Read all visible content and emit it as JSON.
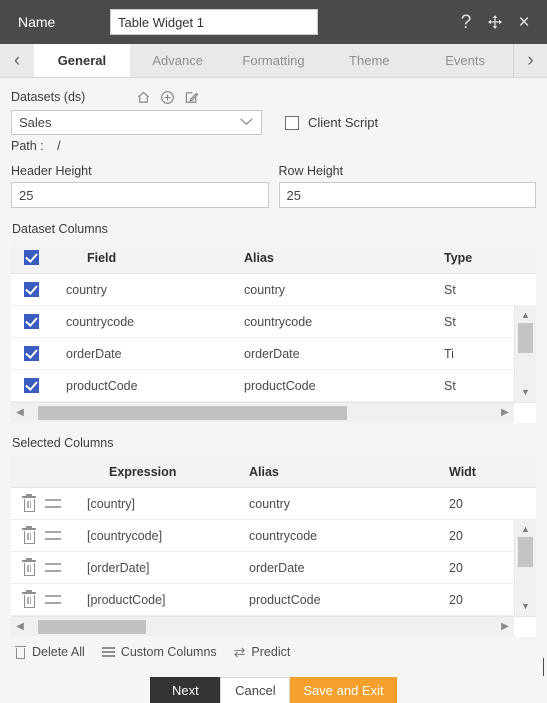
{
  "titlebar": {
    "name_label": "Name",
    "widget_name": "Table Widget 1",
    "icons": {
      "help": "?",
      "move": "move-icon",
      "close": "×"
    }
  },
  "tabbar": {
    "prev": "‹",
    "next": "›",
    "tabs": [
      {
        "label": "General",
        "active": true
      },
      {
        "label": "Advance",
        "active": false
      },
      {
        "label": "Formatting",
        "active": false
      },
      {
        "label": "Theme",
        "active": false
      },
      {
        "label": "Events",
        "active": false
      }
    ]
  },
  "general": {
    "datasets_label": "Datasets (ds)",
    "dataset_value": "Sales",
    "dataset_icons": [
      "home-icon",
      "add-circle-icon",
      "edit-icon"
    ],
    "client_script_label": "Client Script",
    "client_script_checked": false,
    "path_label": "Path :",
    "path_value": "/",
    "header_height_label": "Header Height",
    "header_height_value": "25",
    "row_height_label": "Row Height",
    "row_height_value": "25"
  },
  "dataset_columns": {
    "section_title": "Dataset Columns",
    "headers": {
      "field": "Field",
      "alias": "Alias",
      "type": "Type"
    },
    "header_checked": true,
    "rows": [
      {
        "checked": true,
        "field": "country",
        "alias": "country",
        "type": "St"
      },
      {
        "checked": true,
        "field": "countrycode",
        "alias": "countrycode",
        "type": "St"
      },
      {
        "checked": true,
        "field": "orderDate",
        "alias": "orderDate",
        "type": "Ti"
      },
      {
        "checked": true,
        "field": "productCode",
        "alias": "productCode",
        "type": "St"
      }
    ],
    "hscroll": {
      "left_arrow": "◀",
      "right_arrow": "▶",
      "thumb_left_pct": 2,
      "thumb_width_pct": 66
    },
    "vscroll": {
      "up_arrow": "▲",
      "down_arrow": "▼"
    }
  },
  "selected_columns": {
    "section_title": "Selected Columns",
    "headers": {
      "expression": "Expression",
      "alias": "Alias",
      "width": "Widt"
    },
    "rows": [
      {
        "expression": "[country]",
        "alias": "country",
        "width": "20"
      },
      {
        "expression": "[countrycode]",
        "alias": "countrycode",
        "width": "20"
      },
      {
        "expression": "[orderDate]",
        "alias": "orderDate",
        "width": "20"
      },
      {
        "expression": "[productCode]",
        "alias": "productCode",
        "width": "20"
      }
    ],
    "hscroll": {
      "left_arrow": "◀",
      "right_arrow": "▶",
      "thumb_left_pct": 2,
      "thumb_width_pct": 23
    },
    "vscroll": {
      "up_arrow": "▲",
      "down_arrow": "▼"
    }
  },
  "actions": {
    "delete_all": "Delete All",
    "custom_columns": "Custom Columns",
    "predict": "Predict",
    "predict_icon": "⇄"
  },
  "footer": {
    "next": "Next",
    "cancel": "Cancel",
    "save_and_exit": "Save and Exit"
  },
  "colors": {
    "titlebar_bg": "#4a4a4a",
    "accent_orange": "#f5a02c",
    "checkbox_blue": "#3a5bbf",
    "next_dark": "#333333",
    "panel_bg": "#f5f5f5"
  }
}
